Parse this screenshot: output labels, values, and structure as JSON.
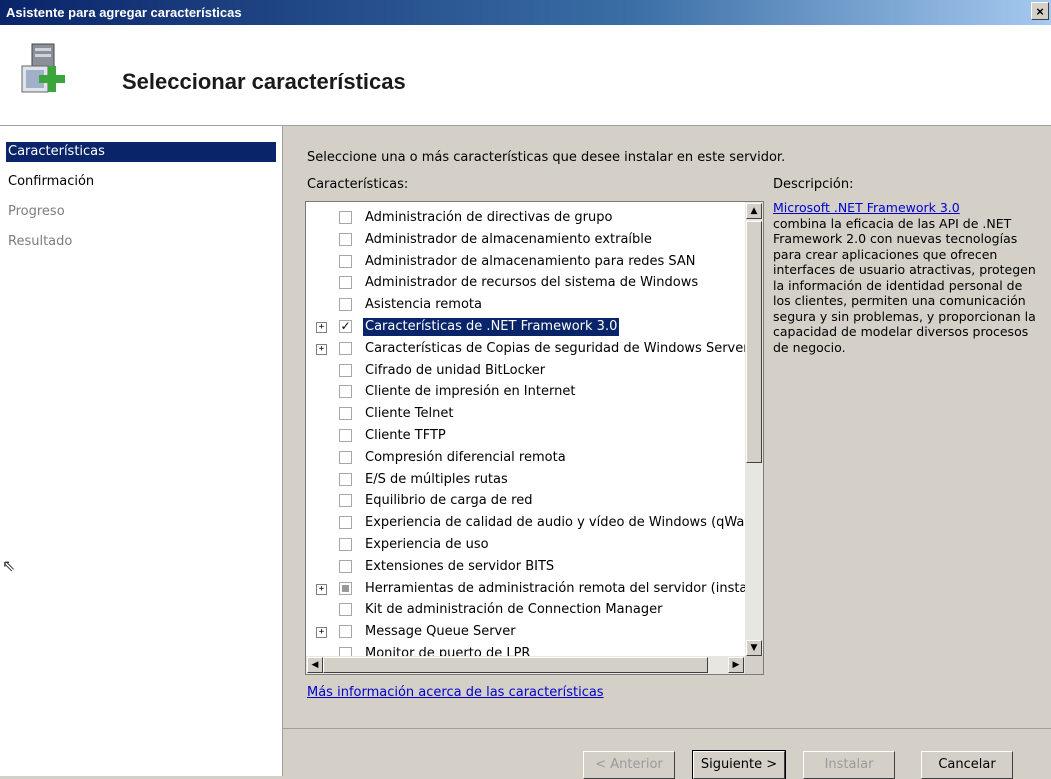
{
  "window": {
    "title": "Asistente para agregar características",
    "close_glyph": "×"
  },
  "header": {
    "title": "Seleccionar características",
    "icon": "server-add-icon"
  },
  "nav": {
    "items": [
      {
        "label": "Características",
        "state": "active"
      },
      {
        "label": "Confirmación",
        "state": "normal"
      },
      {
        "label": "Progreso",
        "state": "disabled"
      },
      {
        "label": "Resultado",
        "state": "disabled"
      }
    ]
  },
  "main": {
    "intro": "Seleccione una o más características que desee instalar en este servidor.",
    "features_label": "Características:",
    "description_label": "Descripción:",
    "description_link": "Microsoft .NET Framework 3.0",
    "description_text": "combina la eficacia de las API de .NET Framework 2.0 con nuevas tecnologías para crear aplicaciones que ofrecen interfaces de usuario atractivas, protegen la información de identidad personal de los clientes, permiten una comunicación segura y sin problemas, y proporcionan la capacidad de modelar diversos procesos de negocio.",
    "more_info_link": "Más información acerca de las características",
    "features": [
      {
        "label": "Administración de directivas de grupo",
        "expandable": false,
        "check": "unchecked",
        "selected": false
      },
      {
        "label": "Administrador de almacenamiento extraíble",
        "expandable": false,
        "check": "unchecked",
        "selected": false
      },
      {
        "label": "Administrador de almacenamiento para redes SAN",
        "expandable": false,
        "check": "unchecked",
        "selected": false
      },
      {
        "label": "Administrador de recursos del sistema de Windows",
        "expandable": false,
        "check": "unchecked",
        "selected": false
      },
      {
        "label": "Asistencia remota",
        "expandable": false,
        "check": "unchecked",
        "selected": false
      },
      {
        "label": "Características de .NET Framework 3.0",
        "expandable": true,
        "check": "checked",
        "selected": true
      },
      {
        "label": "Características de Copias de seguridad de Windows Server",
        "expandable": true,
        "check": "unchecked",
        "selected": false
      },
      {
        "label": "Cifrado de unidad BitLocker",
        "expandable": false,
        "check": "unchecked",
        "selected": false
      },
      {
        "label": "Cliente de impresión en Internet",
        "expandable": false,
        "check": "unchecked",
        "selected": false
      },
      {
        "label": "Cliente Telnet",
        "expandable": false,
        "check": "unchecked",
        "selected": false
      },
      {
        "label": "Cliente TFTP",
        "expandable": false,
        "check": "unchecked",
        "selected": false
      },
      {
        "label": "Compresión diferencial remota",
        "expandable": false,
        "check": "unchecked",
        "selected": false
      },
      {
        "label": "E/S de múltiples rutas",
        "expandable": false,
        "check": "unchecked",
        "selected": false
      },
      {
        "label": "Equilibrio de carga de red",
        "expandable": false,
        "check": "unchecked",
        "selected": false
      },
      {
        "label": "Experiencia de calidad de audio y vídeo de Windows (qWave)",
        "expandable": false,
        "check": "unchecked",
        "selected": false
      },
      {
        "label": "Experiencia de uso",
        "expandable": false,
        "check": "unchecked",
        "selected": false
      },
      {
        "label": "Extensiones de servidor BITS",
        "expandable": false,
        "check": "unchecked",
        "selected": false
      },
      {
        "label": "Herramientas de administración remota del servidor (instaladas)",
        "expandable": true,
        "check": "partial",
        "selected": false
      },
      {
        "label": "Kit de administración de Connection Manager",
        "expandable": false,
        "check": "unchecked",
        "selected": false
      },
      {
        "label": "Message Queue Server",
        "expandable": true,
        "check": "unchecked",
        "selected": false
      },
      {
        "label": "Monitor de puerto de LPR",
        "expandable": false,
        "check": "unchecked",
        "selected": false
      }
    ]
  },
  "footer": {
    "prev": "< Anterior",
    "next": "Siguiente >",
    "install": "Instalar",
    "cancel": "Cancelar"
  },
  "glyphs": {
    "expand": "+",
    "check": "✓",
    "up": "▲",
    "down": "▼",
    "left": "◀",
    "right": "▶"
  },
  "colors": {
    "selection": "#0a246a",
    "link": "#0000cc",
    "panel": "#d4d0c8"
  }
}
